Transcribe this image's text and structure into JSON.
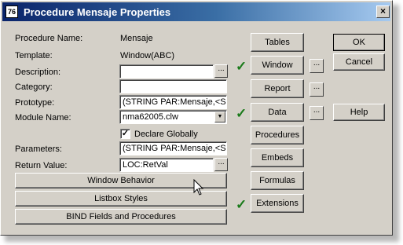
{
  "window": {
    "title": "Procedure Mensaje Properties",
    "icon_label": "76",
    "close_label": "×"
  },
  "fields": {
    "procedure_name": {
      "label": "Procedure Name:",
      "value": "Mensaje"
    },
    "template": {
      "label": "Template:",
      "value": "Window(ABC)"
    },
    "description": {
      "label": "Description:",
      "value": ""
    },
    "category": {
      "label": "Category:",
      "value": ""
    },
    "prototype": {
      "label": "Prototype:",
      "value": "(STRING PAR:Mensaje,<S"
    },
    "module_name": {
      "label": "Module Name:",
      "value": "nma62005.clw"
    },
    "declare_globally": {
      "label": "Declare Globally",
      "checked": true,
      "mark": "✓"
    },
    "parameters": {
      "label": "Parameters:",
      "value": "(STRING PAR:Mensaje,<S"
    },
    "return_value": {
      "label": "Return Value:",
      "value": "LOC:RetVal"
    }
  },
  "ellipsis_label": "...",
  "combo_arrow": "▼",
  "check_mark": "✓",
  "wide_buttons": {
    "window_behavior": "Window Behavior",
    "listbox_styles": "Listbox Styles",
    "bind_fields": "BIND Fields and Procedures"
  },
  "middle_buttons": {
    "tables": "Tables",
    "window": "Window",
    "report": "Report",
    "data": "Data",
    "procedures": "Procedures",
    "embeds": "Embeds",
    "formulas": "Formulas",
    "extensions": "Extensions"
  },
  "right_buttons": {
    "ok": "OK",
    "cancel": "Cancel",
    "help": "Help"
  },
  "colors": {
    "title_gradient_start": "#0a246a",
    "title_gradient_end": "#a6caf0",
    "dialog_face": "#d4d0c8",
    "check_green": "#1a7a1a"
  }
}
